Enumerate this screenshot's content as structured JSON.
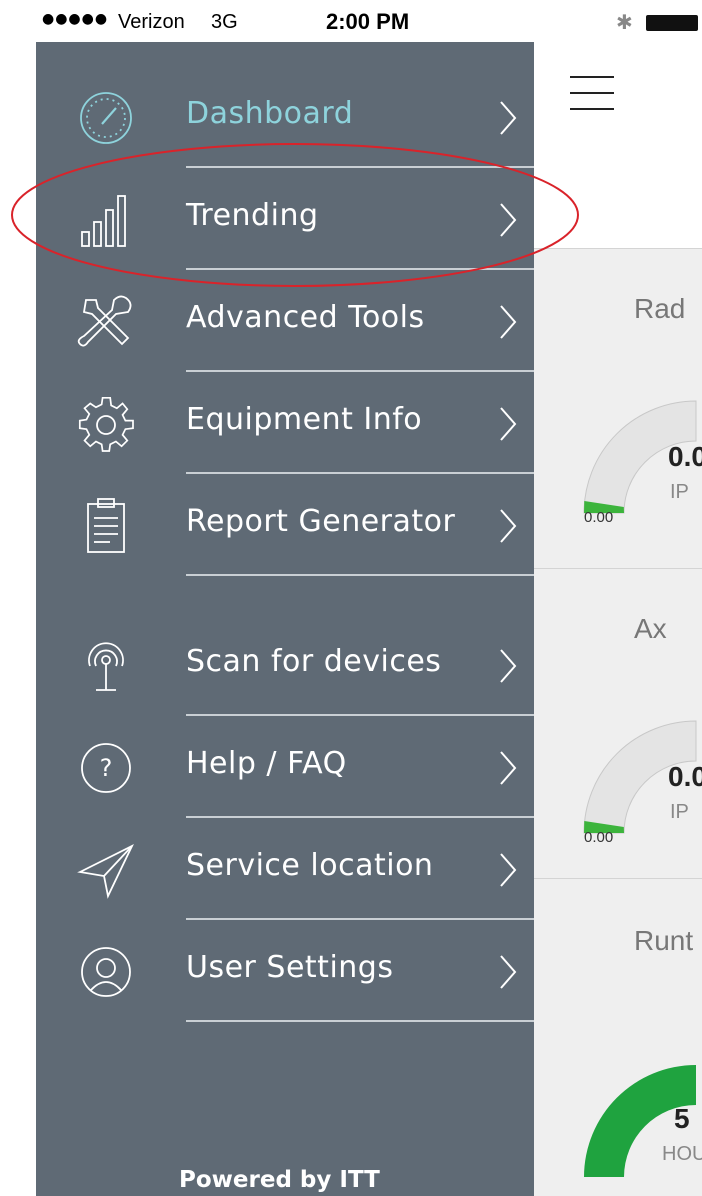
{
  "status_bar": {
    "signal": "●●●●●",
    "carrier": "Verizon",
    "network": "3G",
    "time": "2:00 PM"
  },
  "menu": {
    "items": [
      {
        "label": "Dashboard",
        "icon": "speedometer-icon",
        "active": true
      },
      {
        "label": "Trending",
        "icon": "bar-chart-icon"
      },
      {
        "label": "Advanced Tools",
        "icon": "tools-icon"
      },
      {
        "label": "Equipment Info",
        "icon": "gear-icon"
      },
      {
        "label": "Report Generator",
        "icon": "clipboard-icon"
      },
      {
        "label": "Scan for devices",
        "icon": "antenna-icon"
      },
      {
        "label": "Help / FAQ",
        "icon": "help-icon"
      },
      {
        "label": "Service location",
        "icon": "paper-plane-icon"
      },
      {
        "label": "User Settings",
        "icon": "user-icon"
      }
    ],
    "footer": "Powered by ITT"
  },
  "cards": [
    {
      "title": "Rad",
      "value": "0.0",
      "unit": "IP",
      "min": "0.00",
      "level": 0.02
    },
    {
      "title": "Ax",
      "value": "0.0",
      "unit": "IP",
      "min": "0.00",
      "level": 0.02
    },
    {
      "title": "Runt",
      "value": "5",
      "unit": "HOU",
      "level": 1.0
    }
  ],
  "colors": {
    "menu_bg": "#5f6a75",
    "active_text": "#8ed3dc",
    "highlight": "#d9232a",
    "gauge_green_low": "#3cb43c",
    "gauge_green_full": "#1fa33f"
  }
}
